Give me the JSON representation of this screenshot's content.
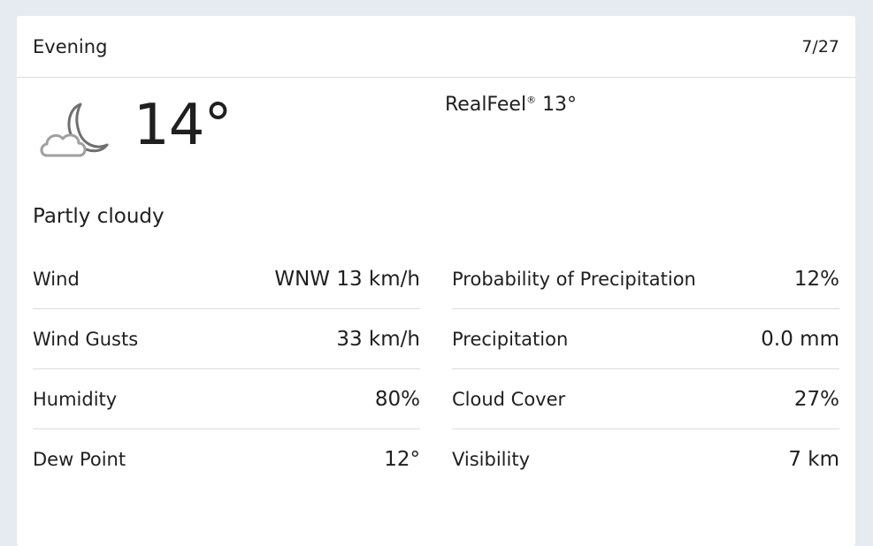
{
  "header": {
    "period": "Evening",
    "date": "7/27"
  },
  "current": {
    "icon": "partly-cloudy-night-icon",
    "temperature": "14°",
    "realfeel_label": "RealFeel",
    "realfeel_mark": "®",
    "realfeel_value": "13°",
    "phrase": "Partly cloudy"
  },
  "details_left": [
    {
      "label": "Wind",
      "value": "WNW 13 km/h"
    },
    {
      "label": "Wind Gusts",
      "value": "33 km/h"
    },
    {
      "label": "Humidity",
      "value": "80%"
    },
    {
      "label": "Dew Point",
      "value": "12°"
    }
  ],
  "details_right": [
    {
      "label": "Probability of Precipitation",
      "value": "12%"
    },
    {
      "label": "Precipitation",
      "value": "0.0 mm"
    },
    {
      "label": "Cloud Cover",
      "value": "27%"
    },
    {
      "label": "Visibility",
      "value": "7 km"
    }
  ]
}
